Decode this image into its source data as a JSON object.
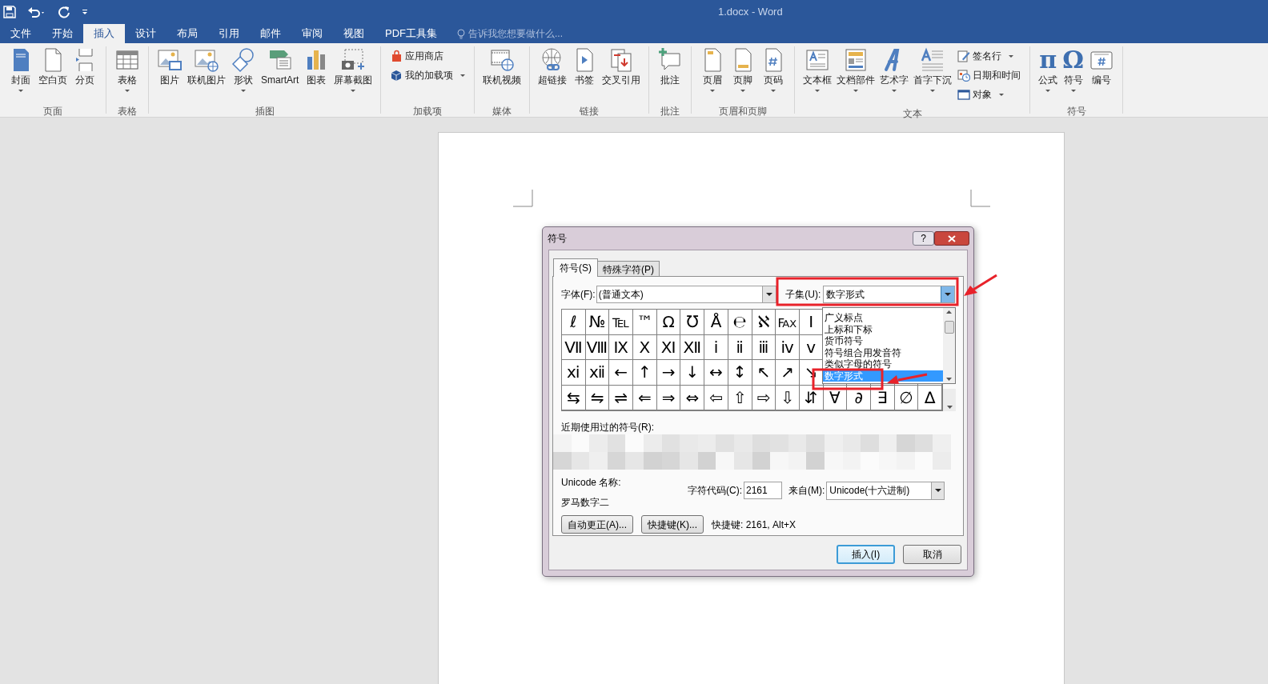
{
  "window": {
    "title": "1.docx - Word"
  },
  "tabs": [
    {
      "label": "文件",
      "selected": false
    },
    {
      "label": "开始",
      "selected": false
    },
    {
      "label": "插入",
      "selected": true
    },
    {
      "label": "设计",
      "selected": false
    },
    {
      "label": "布局",
      "selected": false
    },
    {
      "label": "引用",
      "selected": false
    },
    {
      "label": "邮件",
      "selected": false
    },
    {
      "label": "审阅",
      "selected": false
    },
    {
      "label": "视图",
      "selected": false
    },
    {
      "label": "PDF工具集",
      "selected": false
    }
  ],
  "tell_me": {
    "placeholder": "告诉我您想要做什么..."
  },
  "ribbon_groups": [
    {
      "label": "页面",
      "items": [
        {
          "label": "封面",
          "kind": "large",
          "dropdown": true
        },
        {
          "label": "空白页",
          "kind": "large",
          "dropdown": false
        },
        {
          "label": "分页",
          "kind": "large",
          "dropdown": false
        }
      ]
    },
    {
      "label": "表格",
      "items": [
        {
          "label": "表格",
          "kind": "large",
          "dropdown": true
        }
      ]
    },
    {
      "label": "插图",
      "items": [
        {
          "label": "图片",
          "kind": "large",
          "dropdown": false
        },
        {
          "label": "联机图片",
          "kind": "large",
          "dropdown": false
        },
        {
          "label": "形状",
          "kind": "large",
          "dropdown": true
        },
        {
          "label": "SmartArt",
          "kind": "large",
          "dropdown": false
        },
        {
          "label": "图表",
          "kind": "large",
          "dropdown": false
        },
        {
          "label": "屏幕截图",
          "kind": "large",
          "dropdown": true
        }
      ]
    },
    {
      "label": "加载项",
      "items": [
        {
          "label": "应用商店",
          "kind": "small",
          "dropdown": false
        },
        {
          "label": "我的加载项",
          "kind": "small",
          "dropdown": true
        }
      ]
    },
    {
      "label": "媒体",
      "items": [
        {
          "label": "联机视频",
          "kind": "large",
          "dropdown": false
        }
      ]
    },
    {
      "label": "链接",
      "items": [
        {
          "label": "超链接",
          "kind": "large",
          "dropdown": false
        },
        {
          "label": "书签",
          "kind": "large",
          "dropdown": false
        },
        {
          "label": "交叉引用",
          "kind": "large",
          "dropdown": false
        }
      ]
    },
    {
      "label": "批注",
      "items": [
        {
          "label": "批注",
          "kind": "large",
          "dropdown": false
        }
      ]
    },
    {
      "label": "页眉和页脚",
      "items": [
        {
          "label": "页眉",
          "kind": "large",
          "dropdown": true
        },
        {
          "label": "页脚",
          "kind": "large",
          "dropdown": true
        },
        {
          "label": "页码",
          "kind": "large",
          "dropdown": true
        }
      ]
    },
    {
      "label": "文本",
      "items": [
        {
          "label": "文本框",
          "kind": "large",
          "dropdown": true
        },
        {
          "label": "文档部件",
          "kind": "large",
          "dropdown": true
        },
        {
          "label": "艺术字",
          "kind": "large",
          "dropdown": true
        },
        {
          "label": "首字下沉",
          "kind": "large",
          "dropdown": true
        },
        {
          "label": "签名行",
          "kind": "small",
          "dropdown": true
        },
        {
          "label": "日期和时间",
          "kind": "small",
          "dropdown": false
        },
        {
          "label": "对象",
          "kind": "small",
          "dropdown": true
        }
      ]
    },
    {
      "label": "符号",
      "items": [
        {
          "label": "公式",
          "kind": "large",
          "dropdown": true,
          "glyph": "π"
        },
        {
          "label": "符号",
          "kind": "large",
          "dropdown": true,
          "glyph": "Ω"
        },
        {
          "label": "编号",
          "kind": "large",
          "dropdown": false
        }
      ]
    }
  ],
  "dialog": {
    "title": "符号",
    "help_button": "?",
    "tabs": [
      {
        "label": "符号(S)",
        "selected": true
      },
      {
        "label": "特殊字符(P)",
        "selected": false
      }
    ],
    "font_label": "字体(F):",
    "font_value": "(普通文本)",
    "subset_label": "子集(U):",
    "subset_value": "数字形式",
    "subset_options": [
      {
        "label": "广义标点",
        "selected": false
      },
      {
        "label": "上标和下标",
        "selected": false
      },
      {
        "label": "货币符号",
        "selected": false
      },
      {
        "label": "符号组合用发音符",
        "selected": false
      },
      {
        "label": "类似字母的符号",
        "selected": false
      },
      {
        "label": "数字形式",
        "selected": true
      }
    ],
    "symbol_rows": [
      [
        "ℓ",
        "№",
        "℡",
        "™",
        "Ω",
        "℧",
        "Å",
        "℮",
        "ℵ",
        "℻",
        "Ⅰ"
      ],
      [
        "Ⅶ",
        "Ⅷ",
        "Ⅸ",
        "Ⅹ",
        "Ⅺ",
        "Ⅻ",
        "ⅰ",
        "ⅱ",
        "ⅲ",
        "ⅳ",
        "ⅴ"
      ],
      [
        "ⅺ",
        "ⅻ",
        "←",
        "↑",
        "→",
        "↓",
        "↔",
        "↕",
        "↖",
        "↗",
        "↘"
      ],
      [
        "⇆",
        "⇋",
        "⇌",
        "⇐",
        "⇒",
        "⇔",
        "⇦",
        "⇧",
        "⇨",
        "⇩",
        "⇵",
        "∀",
        "∂",
        "∃",
        "∅",
        "∆"
      ]
    ],
    "recent_label": "近期使用过的符号(R):",
    "unicode_name_label": "Unicode 名称:",
    "unicode_name": "罗马数字二",
    "code_label": "字符代码(C):",
    "code_value": "2161",
    "from_label": "来自(M):",
    "from_value": "Unicode(十六进制)",
    "buttons": [
      "自动更正(A)...",
      "快捷键(K)..."
    ],
    "shortcut_text": "快捷键: 2161, Alt+X",
    "footer_buttons": [
      {
        "label": "插入(I)",
        "default": true
      },
      {
        "label": "取消",
        "default": false
      }
    ]
  }
}
